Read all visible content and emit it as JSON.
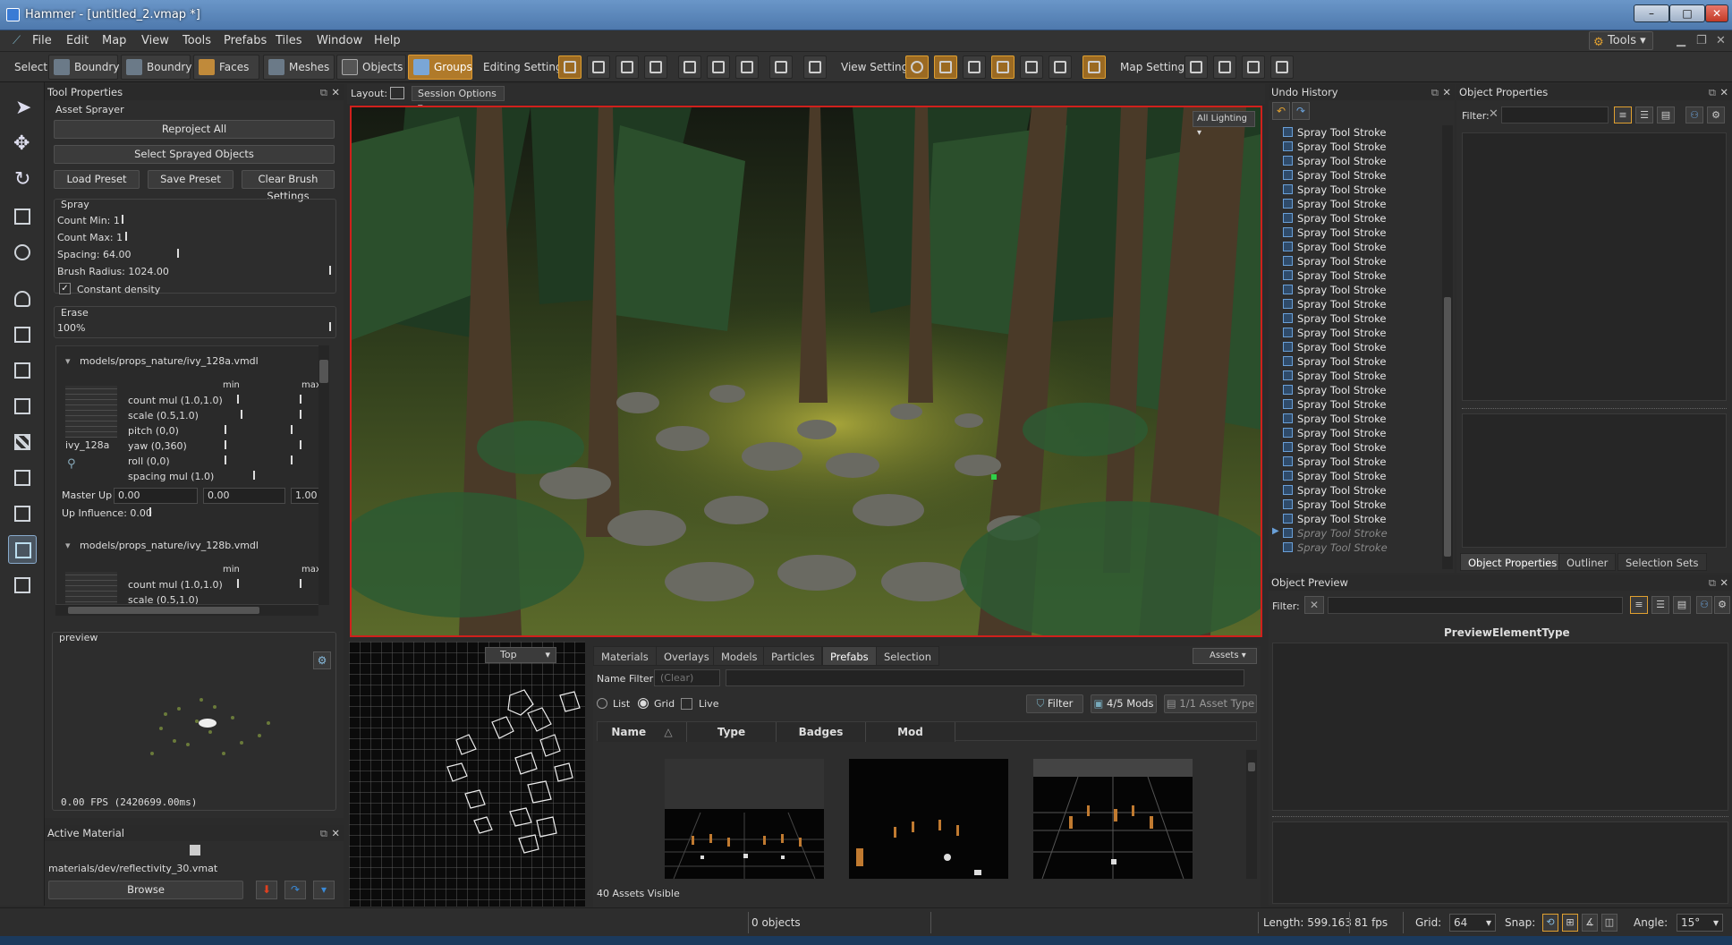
{
  "window": {
    "title": "Hammer - [untitled_2.vmap *]",
    "min": "–",
    "max": "□",
    "close": "✕"
  },
  "menu": [
    "File",
    "Edit",
    "Map",
    "View",
    "Tools",
    "Prefabs",
    "Tiles",
    "Window",
    "Help"
  ],
  "menu_right": "Tools",
  "toolbar": {
    "select_label": "Select:",
    "select_buttons": [
      "Boundry",
      "Boundry",
      "Faces",
      "Meshes",
      "Objects",
      "Groups"
    ],
    "editing_label": "Editing Settings:",
    "view_label": "View Settings:",
    "map_label": "Map Settings:"
  },
  "tool_properties": {
    "title": "Tool Properties",
    "group_title": "Asset Sprayer",
    "reproject": "Reproject All",
    "select_sprayed": "Select Sprayed Objects",
    "load_preset": "Load Preset",
    "save_preset": "Save Preset",
    "clear_brush": "Clear Brush Settings",
    "spray_title": "Spray",
    "count_min": "Count Min:  1",
    "count_max": "Count Max:  1",
    "spacing": "Spacing: 64.00",
    "brush_radius": "Brush Radius: 1024.00",
    "constant_density": "Constant density",
    "erase_title": "Erase",
    "erase_value": "100%",
    "model1": {
      "path": "models/props_nature/ivy_128a.vmdl",
      "name": "ivy_128a",
      "min_label": "min",
      "max_label": "max",
      "params": [
        "count mul (1.0,1.0)",
        "scale (0.5,1.0)",
        "pitch (0,0)",
        "yaw (0,360)",
        "roll (0,0)",
        "spacing mul (1.0)"
      ],
      "master_up_label": "Master Up",
      "master_up": [
        "0.00",
        "0.00",
        "1.00"
      ],
      "up_influence": "Up Influence: 0.00"
    },
    "model2": {
      "path": "models/props_nature/ivy_128b.vmdl",
      "min_label": "min",
      "max_label": "max",
      "params": [
        "count mul (1.0,1.0)",
        "scale (0.5,1.0)"
      ]
    },
    "preview_title": "preview",
    "fps": "0.00 FPS (2420699.00ms)"
  },
  "active_material": {
    "title": "Active Material",
    "path": "materials/dev/reflectivity_30.vmat",
    "browse": "Browse"
  },
  "layout": {
    "label": "Layout:",
    "session": "Session Options"
  },
  "viewport": {
    "lighting": "All Lighting"
  },
  "topview": {
    "mode": "Top"
  },
  "assets": {
    "tabs": [
      "Materials",
      "Overlays",
      "Models",
      "Particles",
      "Prefabs",
      "Selection"
    ],
    "active_tab": "Prefabs",
    "assets_dropdown": "Assets",
    "name_filter_label": "Name Filter:",
    "name_filter_placeholder": "(Clear)",
    "view_list": "List",
    "view_grid": "Grid",
    "view_live": "Live",
    "filter_btn": "Filter",
    "mods_btn": "4/5 Mods",
    "asset_type_btn": "1/1 Asset Type",
    "columns": [
      "Name",
      "Type",
      "Badges",
      "Mod"
    ],
    "visible_count": "40 Assets Visible"
  },
  "undo": {
    "title": "Undo History",
    "items": [
      "Spray Tool Stroke",
      "Spray Tool Stroke",
      "Spray Tool Stroke",
      "Spray Tool Stroke",
      "Spray Tool Stroke",
      "Spray Tool Stroke",
      "Spray Tool Stroke",
      "Spray Tool Stroke",
      "Spray Tool Stroke",
      "Spray Tool Stroke",
      "Spray Tool Stroke",
      "Spray Tool Stroke",
      "Spray Tool Stroke",
      "Spray Tool Stroke",
      "Spray Tool Stroke",
      "Spray Tool Stroke",
      "Spray Tool Stroke",
      "Spray Tool Stroke",
      "Spray Tool Stroke",
      "Spray Tool Stroke",
      "Spray Tool Stroke",
      "Spray Tool Stroke",
      "Spray Tool Stroke",
      "Spray Tool Stroke",
      "Spray Tool Stroke",
      "Spray Tool Stroke",
      "Spray Tool Stroke",
      "Spray Tool Stroke"
    ],
    "future_items": [
      "Spray Tool Stroke",
      "Spray Tool Stroke"
    ]
  },
  "object_properties": {
    "title": "Object Properties",
    "filter_label": "Filter:",
    "tabs": [
      "Object Properties",
      "Outliner",
      "Selection Sets"
    ]
  },
  "object_preview": {
    "title": "Object Preview",
    "filter_label": "Filter:",
    "element_type": "PreviewElementType"
  },
  "status": {
    "objects": "0 objects",
    "length": "Length: 599.163",
    "fps": "81 fps",
    "grid_label": "Grid:",
    "grid_value": "64",
    "snap_label": "Snap:",
    "angle_label": "Angle:",
    "angle_value": "15°"
  },
  "colors": {
    "accent": "#e09a30",
    "viewport_border": "#d0201c",
    "titlebar": "#5b86bb"
  }
}
